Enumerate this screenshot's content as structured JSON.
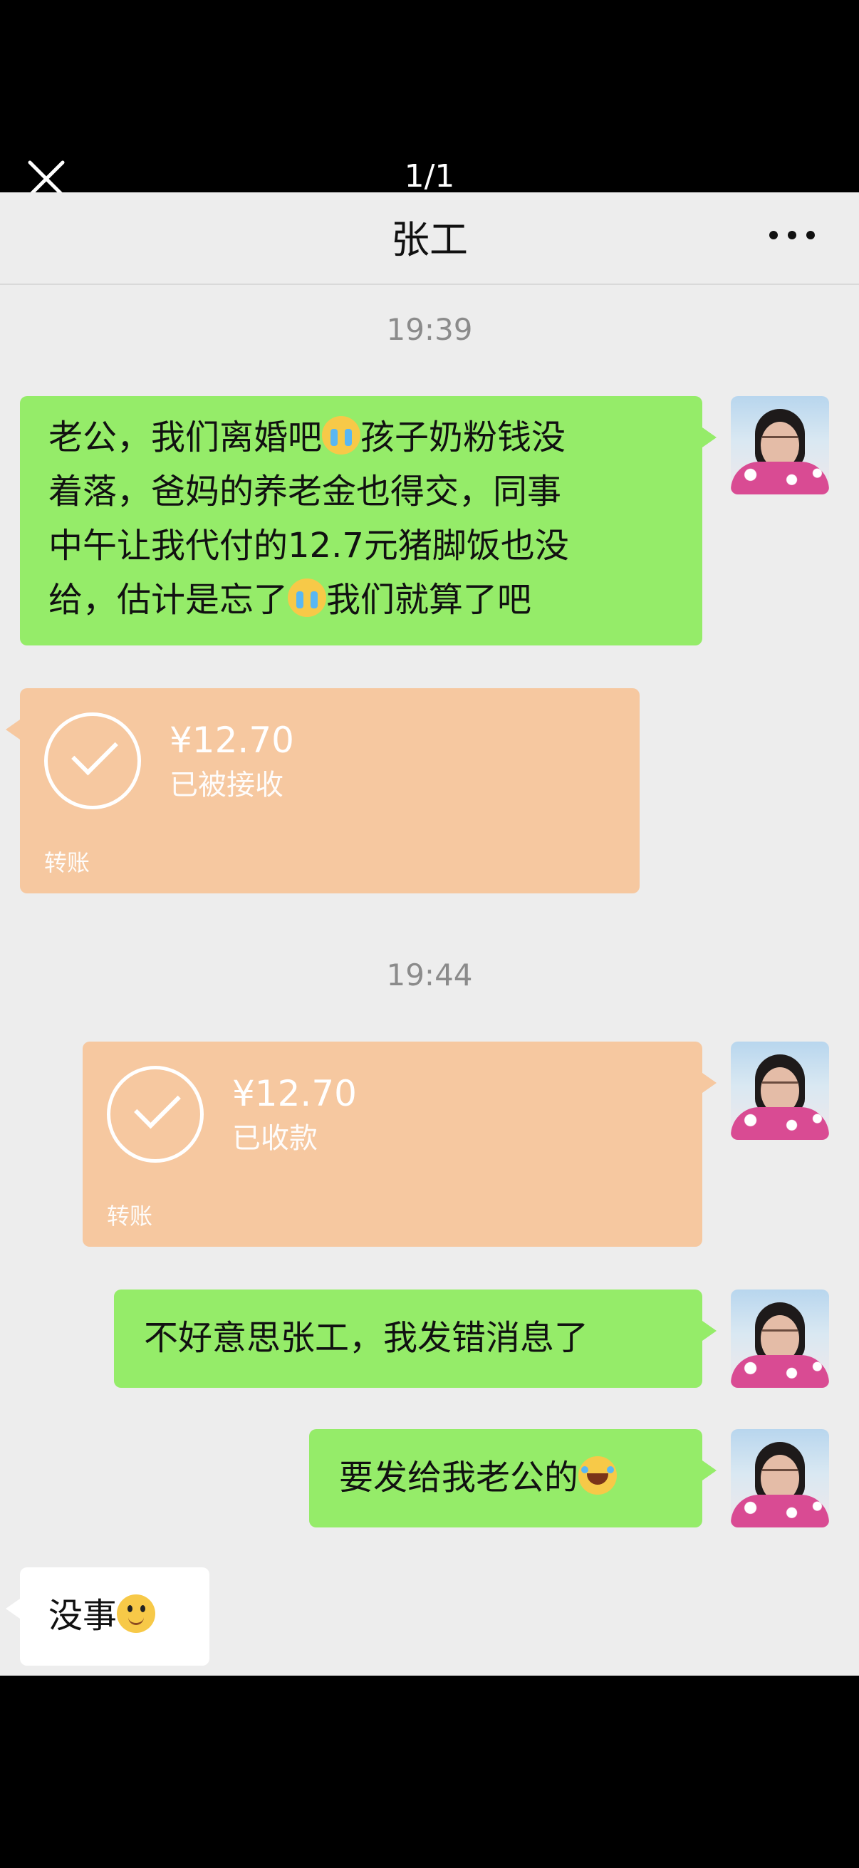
{
  "viewer": {
    "page_indicator": "1/1",
    "close_icon": "close-icon"
  },
  "chat": {
    "title": "张工",
    "more_icon": "more-dots-icon",
    "timestamps": [
      "19:39",
      "19:44"
    ],
    "messages": {
      "m1_line1_a": "老公，我们离婚吧",
      "m1_line1_b": "孩子奶粉钱没",
      "m1_line2": "着落，爸妈的养老金也得交，同事",
      "m1_line3": "中午让我代付的12.7元猪脚饭也没",
      "m1_line4_a": "给，估计是忘了",
      "m1_line4_b": "我们就算了吧",
      "transfer_received_amount": "¥12.70",
      "transfer_received_status": "已被接收",
      "transfer_received_label": "转账",
      "transfer_paid_amount": "¥12.70",
      "transfer_paid_status": "已收款",
      "transfer_paid_label": "转账",
      "m4": "不好意思张工，我发错消息了",
      "m5": "要发给我老公的",
      "m6": "没事"
    }
  }
}
